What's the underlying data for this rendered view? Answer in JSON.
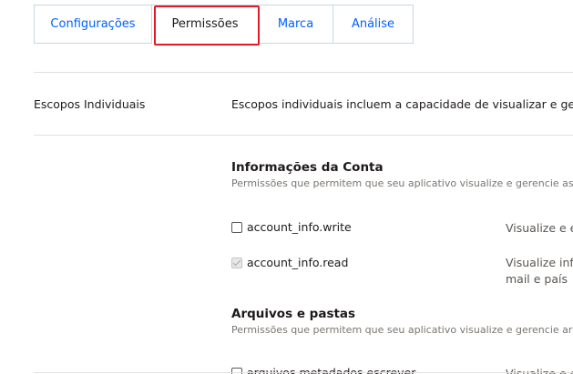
{
  "tabs": [
    {
      "label": "Configurações",
      "active": false
    },
    {
      "label": "Permissões",
      "active": true
    },
    {
      "label": "Marca",
      "active": false
    },
    {
      "label": "Análise",
      "active": false
    }
  ],
  "individual_scopes": {
    "label": "Escopos Individuais",
    "description": "Escopos individuais incluem a capacidade de visualizar e gerenciar"
  },
  "sections": [
    {
      "title": "Informações da Conta",
      "subtitle": "Permissões que permitem que seu aplicativo visualize e gerencie as informações",
      "permissions": [
        {
          "name": "account_info.write",
          "checked": false,
          "disabled": false,
          "description": [
            "Visualize e e"
          ]
        },
        {
          "name": "account_info.read",
          "checked": true,
          "disabled": true,
          "description": [
            "Visualize info",
            "mail e país"
          ]
        }
      ]
    },
    {
      "title": "Arquivos e pastas",
      "subtitle": "Permissões que permitem que seu aplicativo visualize e gerencie arquivos",
      "permissions": [
        {
          "name": "arquivos.metadados.escrever",
          "checked": false,
          "disabled": false,
          "description": [
            "Visualize e e"
          ]
        }
      ]
    }
  ],
  "colors": {
    "link": "#0061fe",
    "highlight": "#e01b24",
    "border": "#c8d6e5",
    "muted_text": "#7a7570"
  }
}
